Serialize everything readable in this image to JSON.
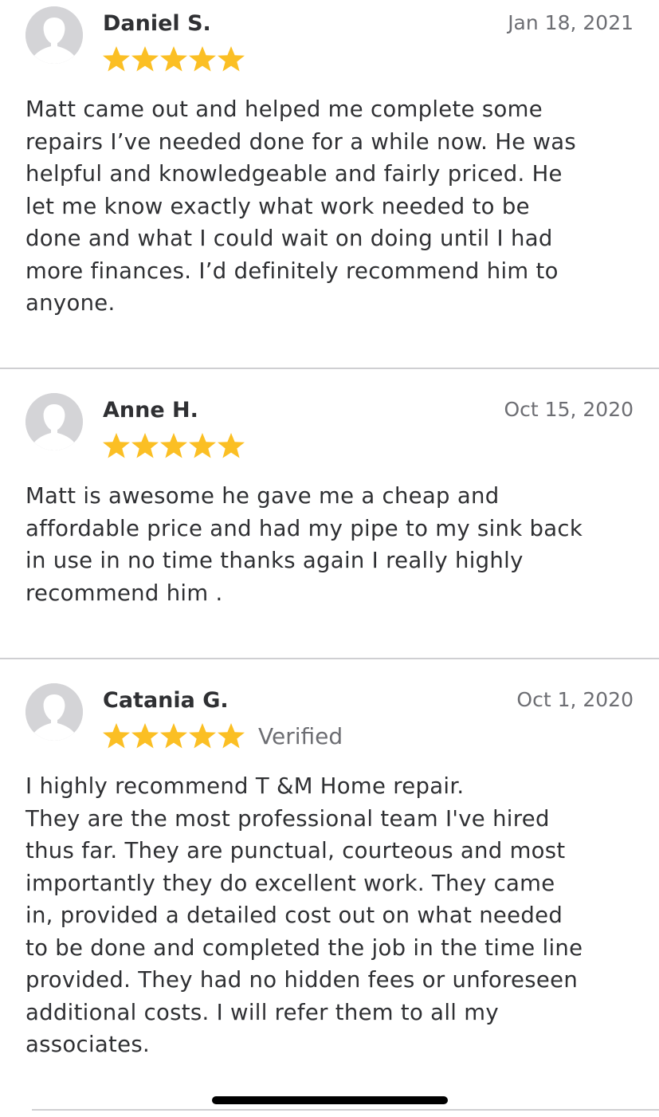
{
  "colors": {
    "star": "#fbbf24",
    "divider": "#cfcfd2",
    "text": "#2f3033",
    "muted": "#6d6e73",
    "avatar": "#d4d4d7"
  },
  "reviews": [
    {
      "avatar_icon": "user-silhouette-icon",
      "name": "Daniel S.",
      "date": "Jan 18, 2021",
      "rating": 5,
      "verified": "",
      "lines": [
        "Matt came out and helped me complete some",
        "repairs I’ve needed done for a while now. He was",
        "helpful and knowledgeable and fairly priced. He",
        "let me know exactly what work needed to be",
        "done and what I could wait on doing until I had",
        "more finances. I’d definitely recommend him to",
        "anyone."
      ]
    },
    {
      "avatar_icon": "user-silhouette-icon",
      "name": "Anne H.",
      "date": "Oct 15, 2020",
      "rating": 5,
      "verified": "",
      "lines": [
        "Matt is  awesome he gave me a cheap and",
        "affordable price and had my pipe to my sink back",
        "in use in no time thanks again I really highly",
        "recommend him ."
      ]
    },
    {
      "avatar_icon": "user-silhouette-icon",
      "name": "Catania G.",
      "date": "Oct 1, 2020",
      "rating": 5,
      "verified": "Verified",
      "lines": [
        "I highly recommend T &M Home repair.",
        "They are the most professional team I've hired",
        "thus far. They are punctual, courteous and most",
        "importantly they do excellent work.  They came",
        "in, provided a detailed cost out on what needed",
        "to be done and completed the job in the time line",
        "provided. They had no hidden fees or unforeseen",
        "additional costs.  I will refer them to all my",
        "associates."
      ]
    }
  ]
}
